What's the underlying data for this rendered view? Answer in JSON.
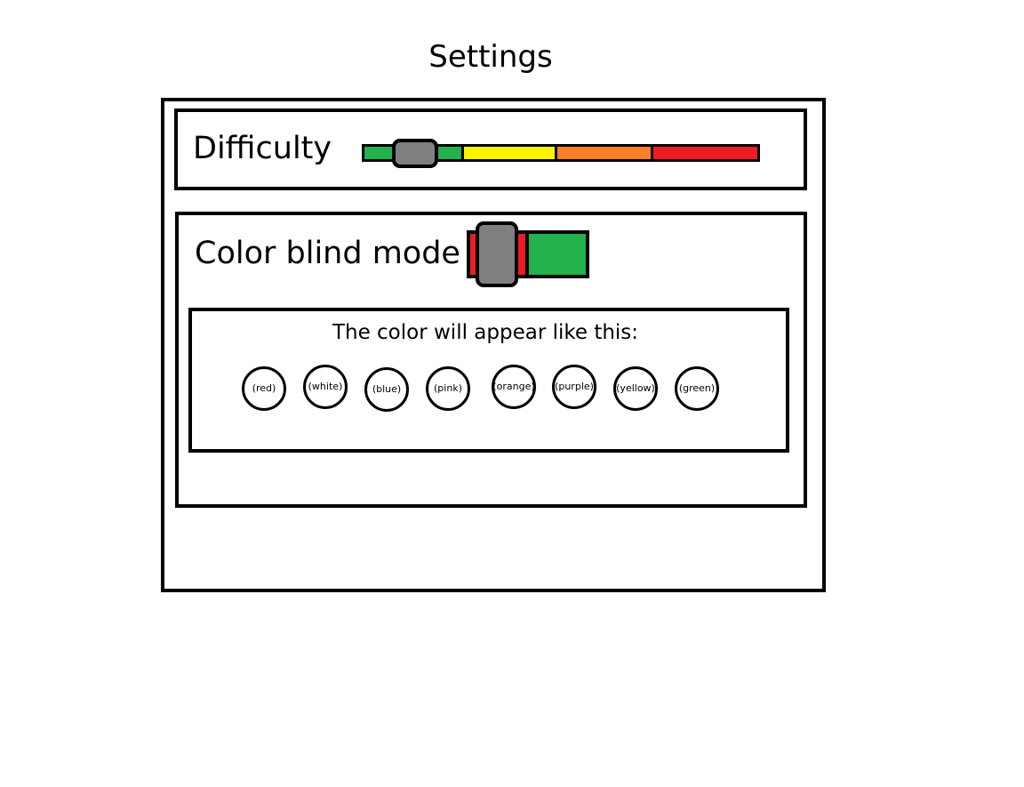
{
  "page": {
    "title": "Settings"
  },
  "difficulty": {
    "label": "Difficulty",
    "level_fraction": 0.12,
    "segments": [
      {
        "color": "#22b14c"
      },
      {
        "color": "#fff200"
      },
      {
        "color": "#ff7f27"
      },
      {
        "color": "#ed1c24"
      }
    ]
  },
  "color_blind_mode": {
    "label": "Color blind mode",
    "state": "off",
    "off_color": "#ed1c24",
    "on_color": "#22b14c"
  },
  "preview": {
    "caption": "The color will appear like this:",
    "swatches": [
      {
        "label": "(red)"
      },
      {
        "label": "(white)"
      },
      {
        "label": "(blue)"
      },
      {
        "label": "(pink)"
      },
      {
        "label": "(orange)"
      },
      {
        "label": "(purple)"
      },
      {
        "label": "(yellow)"
      },
      {
        "label": "(green)"
      }
    ]
  }
}
